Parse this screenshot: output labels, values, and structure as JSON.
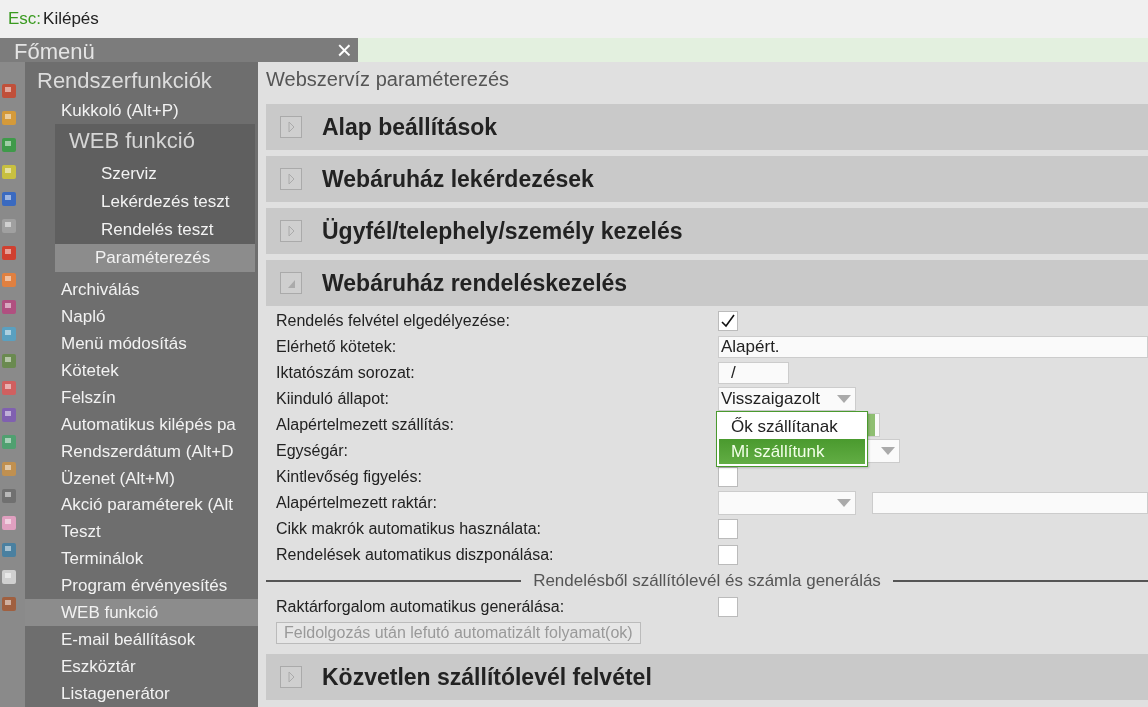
{
  "top_bar": {
    "key": "Esc:",
    "label": "Kilépés"
  },
  "menu": {
    "title": "Főmenü",
    "close": "×",
    "panel_title": "Rendszerfunkciók",
    "items_before": [
      {
        "label": "Kukkoló (Alt+P)",
        "selected": false
      }
    ],
    "submenu": {
      "title": "WEB funkció",
      "items": [
        {
          "label": "Szerviz",
          "selected": false
        },
        {
          "label": "Lekérdezés teszt",
          "selected": false
        },
        {
          "label": "Rendelés teszt",
          "selected": false
        },
        {
          "label": "Paraméterezés",
          "selected": true
        }
      ]
    },
    "items_after": [
      {
        "label": "Archiválás",
        "selected": false
      },
      {
        "label": "Napló",
        "selected": false
      },
      {
        "label": "Menü módosítás",
        "selected": false
      },
      {
        "label": "Kötetek",
        "selected": false
      },
      {
        "label": "Felszín",
        "selected": false
      },
      {
        "label": "Automatikus kilépés pa",
        "selected": false
      },
      {
        "label": "Rendszerdátum (Alt+D",
        "selected": false
      },
      {
        "label": "Üzenet (Alt+M)",
        "selected": false
      },
      {
        "label": "Akció paraméterek (Alt",
        "selected": false
      },
      {
        "label": "Teszt",
        "selected": false
      },
      {
        "label": "Terminálok",
        "selected": false
      },
      {
        "label": "Program érvényesítés",
        "selected": false
      },
      {
        "label": "WEB funkció",
        "selected": true
      },
      {
        "label": "E-mail beállítások",
        "selected": false
      },
      {
        "label": "Eszköztár",
        "selected": false
      },
      {
        "label": "Listagenerátor",
        "selected": false
      }
    ]
  },
  "main": {
    "title": "Webszervíz paraméterezés",
    "sections": [
      {
        "title": "Alap beállítások",
        "expanded": false
      },
      {
        "title": "Webáruház lekérdezések",
        "expanded": false
      },
      {
        "title": "Ügyfél/telephely/személy kezelés",
        "expanded": false
      },
      {
        "title": "Webáruház rendeléskezelés",
        "expanded": true,
        "rows": [
          {
            "kind": "checkbox",
            "label": "Rendelés felvétel elgedélyezése:",
            "checked": true
          },
          {
            "kind": "text",
            "label": "Elérhető kötetek:",
            "value": "Alapért."
          },
          {
            "kind": "short_text",
            "label": "Iktatószám sorozat:",
            "value": "/"
          },
          {
            "kind": "select",
            "label": "Kiinduló állapot:",
            "value": "Visszaigazolt",
            "open": false
          },
          {
            "kind": "select",
            "label": "Alapértelmezett szállítás:",
            "open": true,
            "options": [
              {
                "label": "Ők szállítanak",
                "selected": false
              },
              {
                "label": "Mi szállítunk",
                "selected": true
              }
            ]
          },
          {
            "kind": "select",
            "label": "Egységár:",
            "open": false
          },
          {
            "kind": "checkbox",
            "label": "Kintlevőség figyelés:",
            "checked": false
          },
          {
            "kind": "warehouse",
            "label": "Alapértelmezett raktár:"
          },
          {
            "kind": "checkbox",
            "label": "Cikk makrók automatikus használata:",
            "checked": false
          },
          {
            "kind": "checkbox",
            "label": "Rendelések automatikus diszponálása:",
            "checked": false
          },
          {
            "kind": "divider",
            "label": "Rendelésből szállítólevél és számla generálás"
          },
          {
            "kind": "checkbox",
            "label": "Raktárforgalom automatikus generálása:",
            "checked": false
          },
          {
            "kind": "button",
            "label": "Feldolgozás után lefutó automatizált folyamat(ok)",
            "disabled": true
          }
        ]
      },
      {
        "title": "Közvetlen szállítólevél felvétel",
        "expanded": false
      }
    ]
  }
}
